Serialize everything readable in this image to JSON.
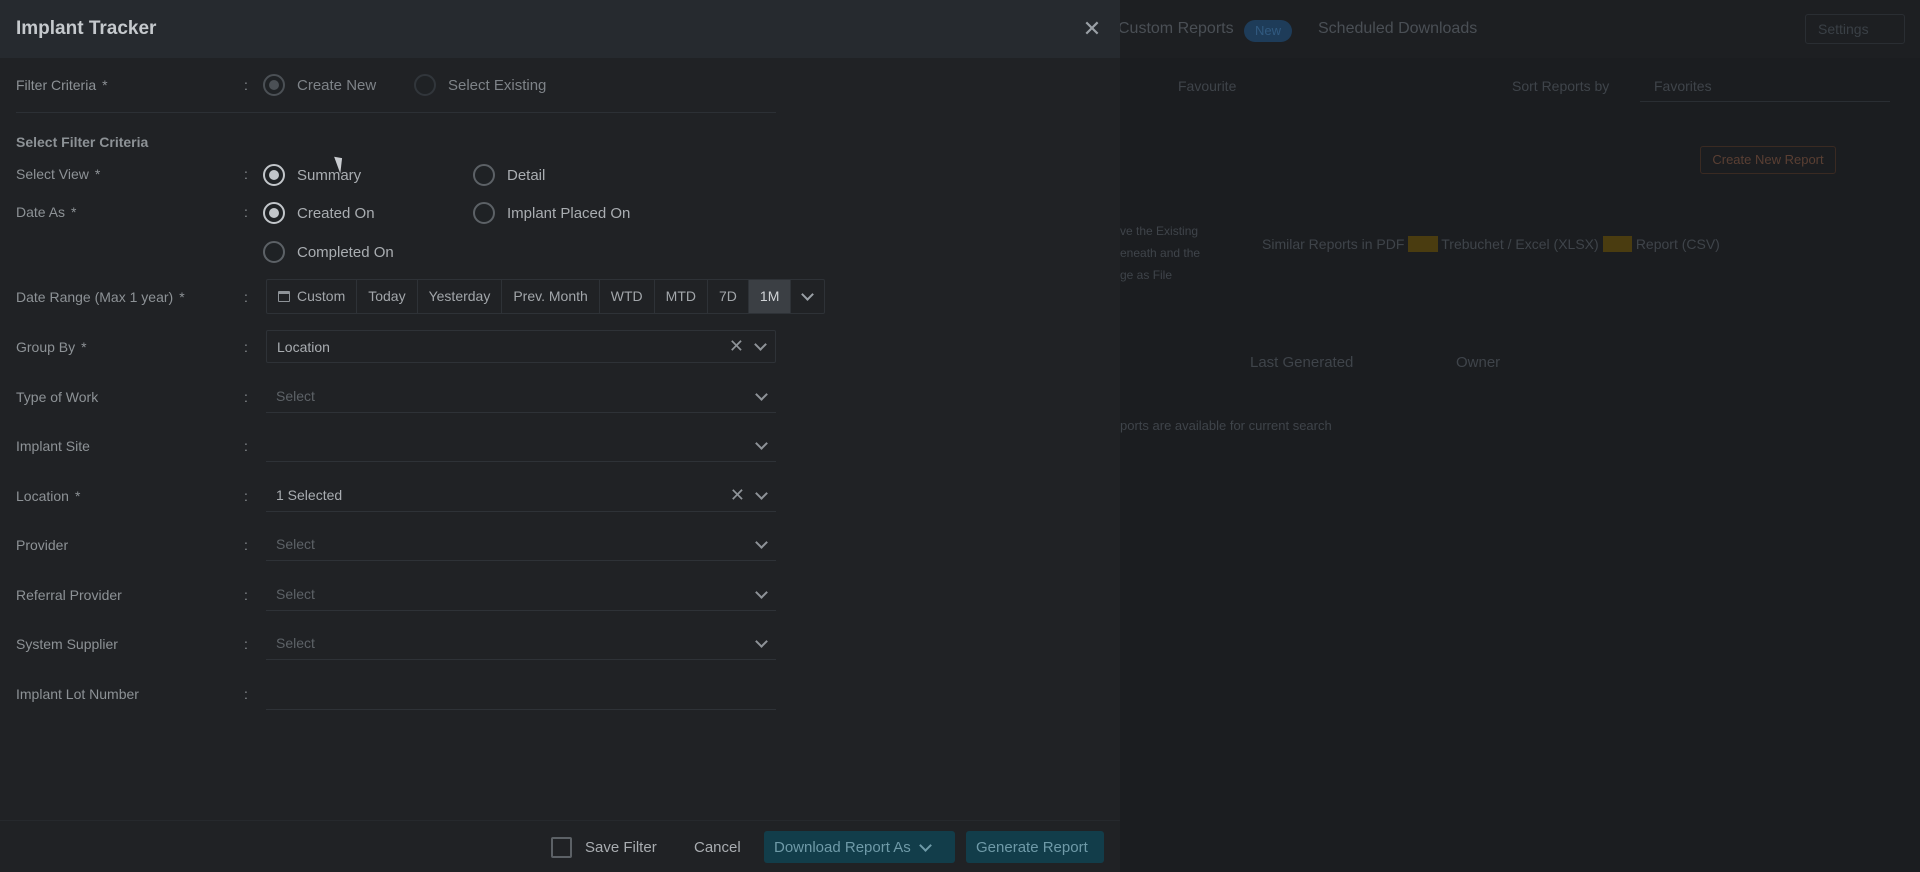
{
  "modal": {
    "title": "Implant Tracker",
    "close_icon": "close-icon"
  },
  "filter_criteria": {
    "label": "Filter Criteria",
    "required": "*",
    "options": [
      {
        "label": "Create New",
        "selected": true
      },
      {
        "label": "Select Existing",
        "selected": false
      }
    ]
  },
  "section_title": "Select Filter Criteria",
  "select_view": {
    "label": "Select View",
    "required": "*",
    "options": [
      {
        "label": "Summary",
        "selected": true
      },
      {
        "label": "Detail",
        "selected": false
      }
    ]
  },
  "date_as": {
    "label": "Date As",
    "required": "*",
    "options": [
      {
        "label": "Created On",
        "selected": true
      },
      {
        "label": "Implant Placed On",
        "selected": false
      },
      {
        "label": "Completed On",
        "selected": false
      }
    ]
  },
  "date_range": {
    "label": "Date Range (Max 1 year)",
    "required": "*",
    "options": [
      "Custom",
      "Today",
      "Yesterday",
      "Prev. Month",
      "WTD",
      "MTD",
      "7D",
      "1M"
    ],
    "active": "1M"
  },
  "group_by": {
    "label": "Group By",
    "required": "*",
    "value": "Location"
  },
  "type_of_work": {
    "label": "Type of Work",
    "placeholder": "Select"
  },
  "implant_site": {
    "label": "Implant Site",
    "value": ""
  },
  "location": {
    "label": "Location",
    "required": "*",
    "value": "1 Selected"
  },
  "provider": {
    "label": "Provider",
    "placeholder": "Select"
  },
  "referral_provider": {
    "label": "Referral Provider",
    "placeholder": "Select"
  },
  "system_supplier": {
    "label": "System Supplier",
    "placeholder": "Select"
  },
  "implant_lot_number": {
    "label": "Implant Lot Number",
    "value": ""
  },
  "colon": ":",
  "footer": {
    "save_filter": "Save Filter",
    "cancel": "Cancel",
    "download_report": "Download Report As",
    "generate_report": "Generate Report"
  },
  "background": {
    "tabs": [
      "Custom Reports",
      "Scheduled Downloads"
    ],
    "badge": "New",
    "settings": "Settings",
    "sort_label": "Sort Reports by",
    "sort_value": "Favorites",
    "create_button": "Create New Report",
    "columns": [
      "Last Generated",
      "Owner"
    ],
    "favourite": "Favourite",
    "note_lines": [
      "ve the Existing",
      "eneath and the",
      "ge as File"
    ],
    "format_prefix": "Similar Reports in PDF",
    "format_mid": "Trebuchet / Excel (XLSX)",
    "format_suffix": "Report (CSV)",
    "empty_text": "ports are available for current search"
  }
}
